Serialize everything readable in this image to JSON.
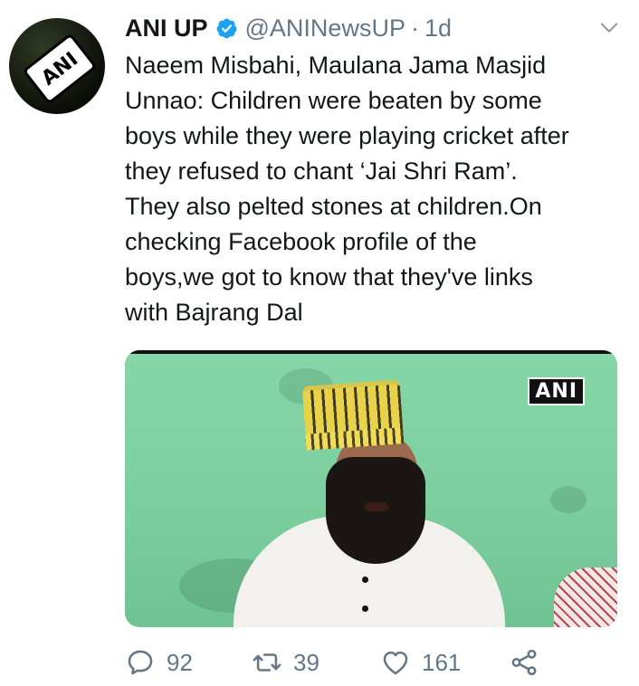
{
  "tweet": {
    "display_name": "ANI UP",
    "handle": "@ANINewsUP",
    "separator": "·",
    "time": "1d",
    "avatar_text": "ANI",
    "text_lines": [
      "Naeem Misbahi, Maulana Jama Masjid",
      "Unnao: Children were beaten by some",
      "boys while they were playing cricket after",
      "they refused to chant ‘Jai Shri Ram’.",
      "They also pelted stones at children.On",
      "checking Facebook profile of the",
      "boys,we got to know that they've links",
      "with Bajrang Dal"
    ],
    "media": {
      "watermark": "ANI"
    },
    "actions": {
      "reply_count": "92",
      "retweet_count": "39",
      "like_count": "161"
    }
  },
  "colors": {
    "verified": "#1da1f2",
    "secondary_text": "#657786",
    "primary_text": "#14171a",
    "icon": "#657786"
  },
  "icons": {
    "verified": "verified-badge-icon",
    "caret": "chevron-down-icon",
    "reply": "reply-icon",
    "retweet": "retweet-icon",
    "like": "heart-icon",
    "share": "share-icon"
  }
}
